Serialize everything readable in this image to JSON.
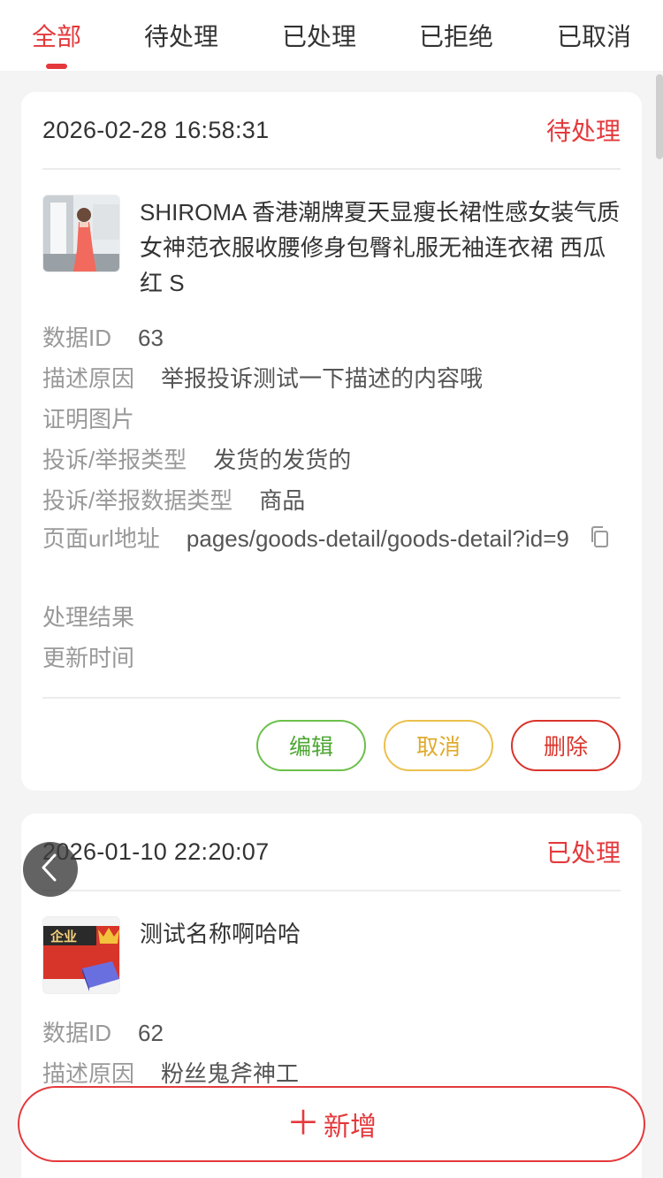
{
  "tabs": [
    {
      "label": "全部",
      "active": true
    },
    {
      "label": "待处理",
      "active": false
    },
    {
      "label": "已处理",
      "active": false
    },
    {
      "label": "已拒绝",
      "active": false
    },
    {
      "label": "已取消",
      "active": false
    }
  ],
  "records": [
    {
      "time": "2026-02-28 16:58:31",
      "status": "待处理",
      "goods_name": "SHIROMA 香港潮牌夏天显瘦长裙性感女装气质女神范衣服收腰修身包臀礼服无袖连衣裙 西瓜红 S",
      "fields": {
        "data_id_label": "数据ID",
        "data_id": "63",
        "reason_label": "描述原因",
        "reason": "举报投诉测试一下描述的内容哦",
        "proof_label": "证明图片",
        "type_label": "投诉/举报类型",
        "type": "发货的发货的",
        "data_type_label": "投诉/举报数据类型",
        "data_type": "商品",
        "url_label": "页面url地址",
        "url": "pages/goods-detail/goods-detail?id=9",
        "result_label": "处理结果",
        "update_label": "更新时间"
      },
      "actions": {
        "edit": "编辑",
        "cancel": "取消",
        "delete": "删除"
      }
    },
    {
      "time": "2026-01-10 22:20:07",
      "status": "已处理",
      "goods_name": "测试名称啊哈哈",
      "thumb_text": "企业",
      "fields": {
        "data_id_label": "数据ID",
        "data_id": "62",
        "reason_label": "描述原因",
        "reason": "粉丝鬼斧神工"
      }
    }
  ],
  "add_button": {
    "icon": "plus-icon",
    "label": "新增"
  },
  "colors": {
    "accent": "#e4393c",
    "edit": "#6cc04a",
    "cancel": "#ebc04c",
    "delete": "#d9342b"
  }
}
